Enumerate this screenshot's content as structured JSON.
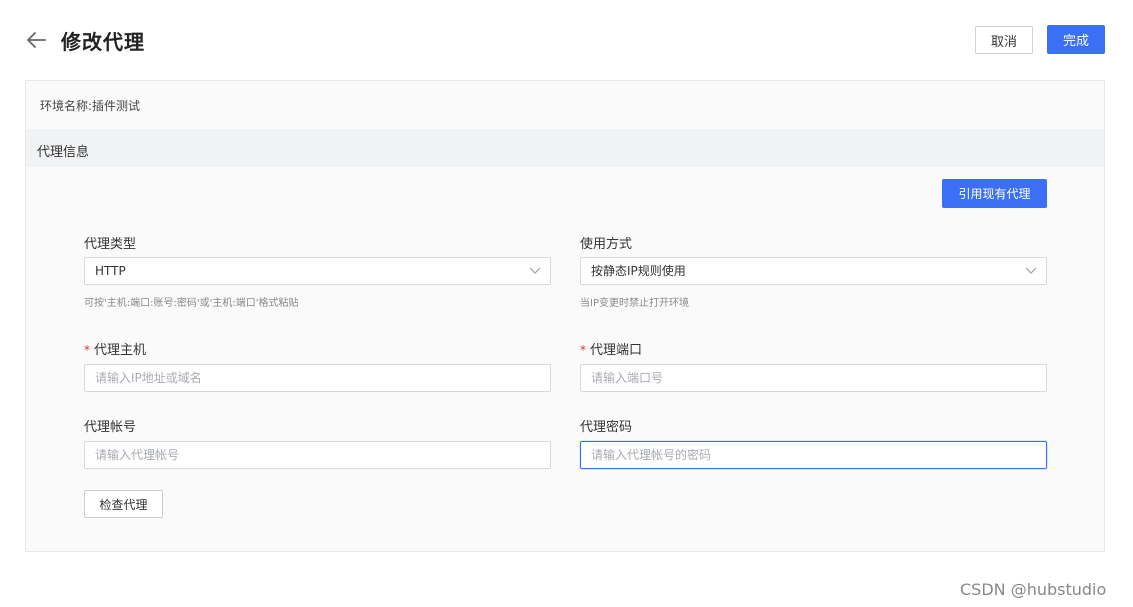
{
  "header": {
    "title": "修改代理",
    "cancel_label": "取消",
    "done_label": "完成",
    "accent_color": "#3b6ff5"
  },
  "env": {
    "label": "环境名称:",
    "value": "插件测试"
  },
  "section": {
    "title": "代理信息",
    "reference_button": "引用现有代理"
  },
  "form": {
    "proxy_type": {
      "label": "代理类型",
      "value": "HTTP",
      "hint": "可按'主机:端口:账号:密码'或'主机:端口'格式粘贴"
    },
    "usage_mode": {
      "label": "使用方式",
      "value": "按静态IP规则使用",
      "hint": "当IP变更时禁止打开环境"
    },
    "proxy_host": {
      "required_mark": "*",
      "label": "代理主机",
      "placeholder": "请输入IP地址或域名"
    },
    "proxy_port": {
      "required_mark": "*",
      "label": "代理端口",
      "placeholder": "请输入端口号"
    },
    "proxy_account": {
      "label": "代理帐号",
      "placeholder": "请输入代理帐号"
    },
    "proxy_password": {
      "label": "代理密码",
      "placeholder": "请输入代理帐号的密码"
    },
    "check_button": "检查代理"
  },
  "watermark": "CSDN @hubstudio",
  "icons": {
    "back": "back-arrow-icon",
    "dropdown": "chevron-down-icon"
  }
}
